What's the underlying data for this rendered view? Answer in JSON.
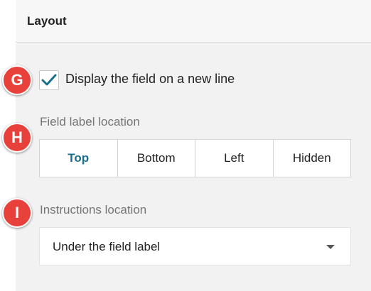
{
  "header": {
    "title": "Layout"
  },
  "markers": {
    "g": "G",
    "h": "H",
    "i": "I"
  },
  "new_line": {
    "label": "Display the field on a new line",
    "checked": true
  },
  "label_location": {
    "title": "Field label location",
    "options": [
      "Top",
      "Bottom",
      "Left",
      "Hidden"
    ],
    "selected": "Top"
  },
  "instructions_location": {
    "title": "Instructions location",
    "value": "Under the field label"
  },
  "colors": {
    "accent": "#1a6f8c",
    "marker": "#e8413b",
    "panel": "#f2f2f2"
  }
}
